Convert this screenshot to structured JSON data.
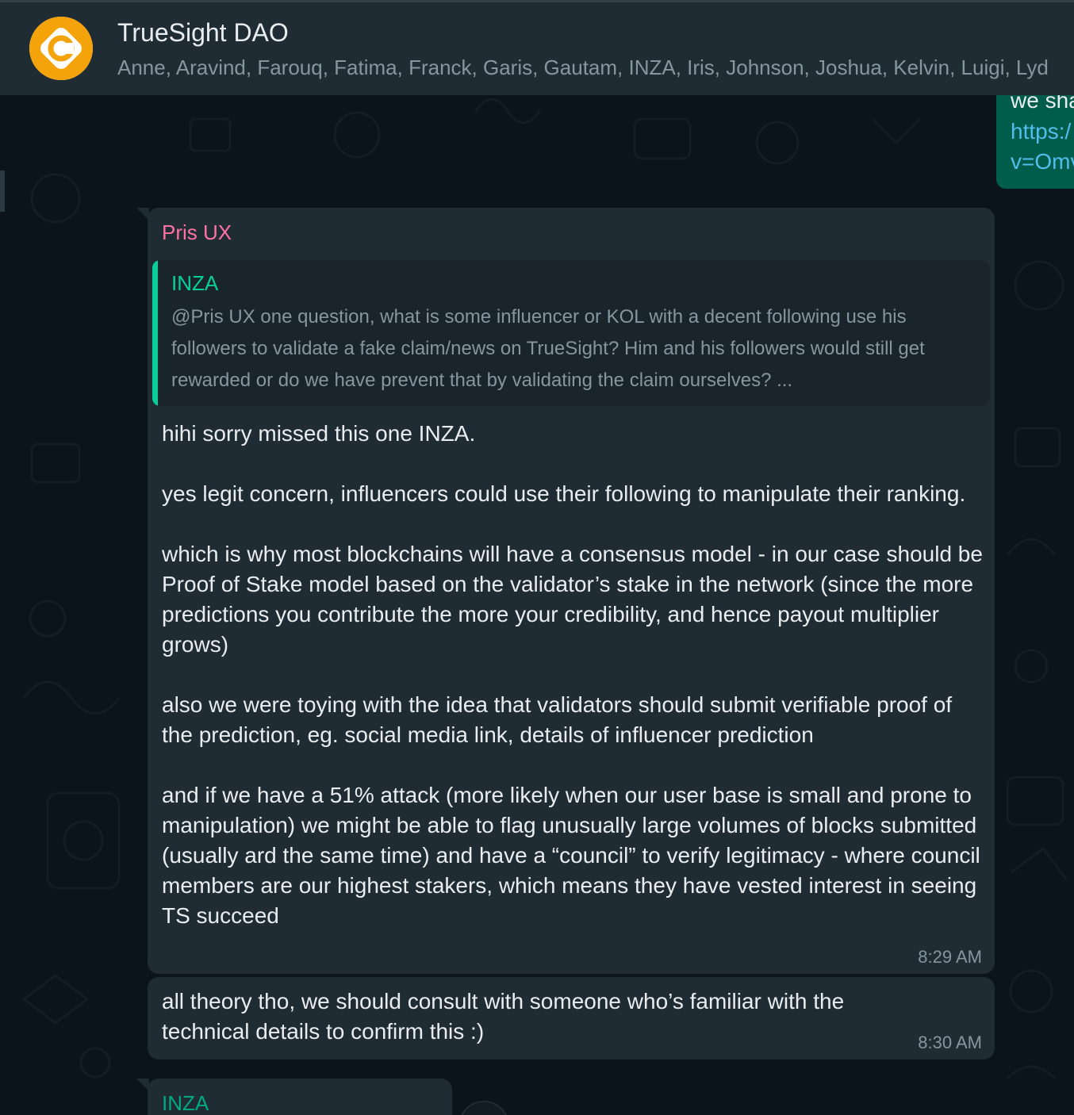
{
  "header": {
    "title": "TrueSight DAO",
    "members": "Anne, Aravind, Farouq, Fatima, Franck, Garis, Gautam, INZA, Iris, Johnson, Joshua, Kelvin, Luigi, Lyd",
    "avatar_icon": "truesight-logo-icon"
  },
  "colors": {
    "header_bg": "#202c33",
    "chat_bg": "#0b141a",
    "bubble_in": "#202c33",
    "bubble_out": "#005c4b",
    "accent": "#00a884",
    "link": "#53bdeb",
    "sender_pink": "#ff72a1",
    "logo_orange": "#f5a30a"
  },
  "outgoing_partial": {
    "line1": "we sha",
    "line2": "https:/",
    "line3": "v=Omv"
  },
  "messages": [
    {
      "sender": "Pris UX",
      "quote": {
        "sender": "INZA",
        "text": "@Pris UX  one question, what is some influencer or KOL with a decent following use his followers to validate a fake claim/news on TrueSight? Him and his followers would still get rewarded or do we have prevent that by validating the claim ourselves? ..."
      },
      "text": "hihi sorry missed this one INZA.\n\nyes legit concern, influencers could use their following to manipulate their ranking.\n\nwhich is why most blockchains will have a consensus model - in our case should be Proof of Stake model based on the validator’s stake in the network (since the more predictions you contribute the more your credibility, and hence payout multiplier grows)\n\nalso we were toying with the idea that validators should submit verifiable proof of the prediction, eg. social media link, details of influencer prediction\n\nand if we have a 51% attack (more likely when our user base is small and prone to manipulation) we might be able to flag unusually large volumes of blocks submitted (usually ard the same time) and have a “council” to verify legitimacy - where council members are our highest stakers, which means they have vested interest in seeing TS succeed",
      "time": "8:29 AM"
    },
    {
      "text": "all theory tho, we should consult with someone who’s familiar with the technical details to confirm this :)",
      "time": "8:30 AM"
    },
    {
      "sender": "INZA"
    }
  ]
}
